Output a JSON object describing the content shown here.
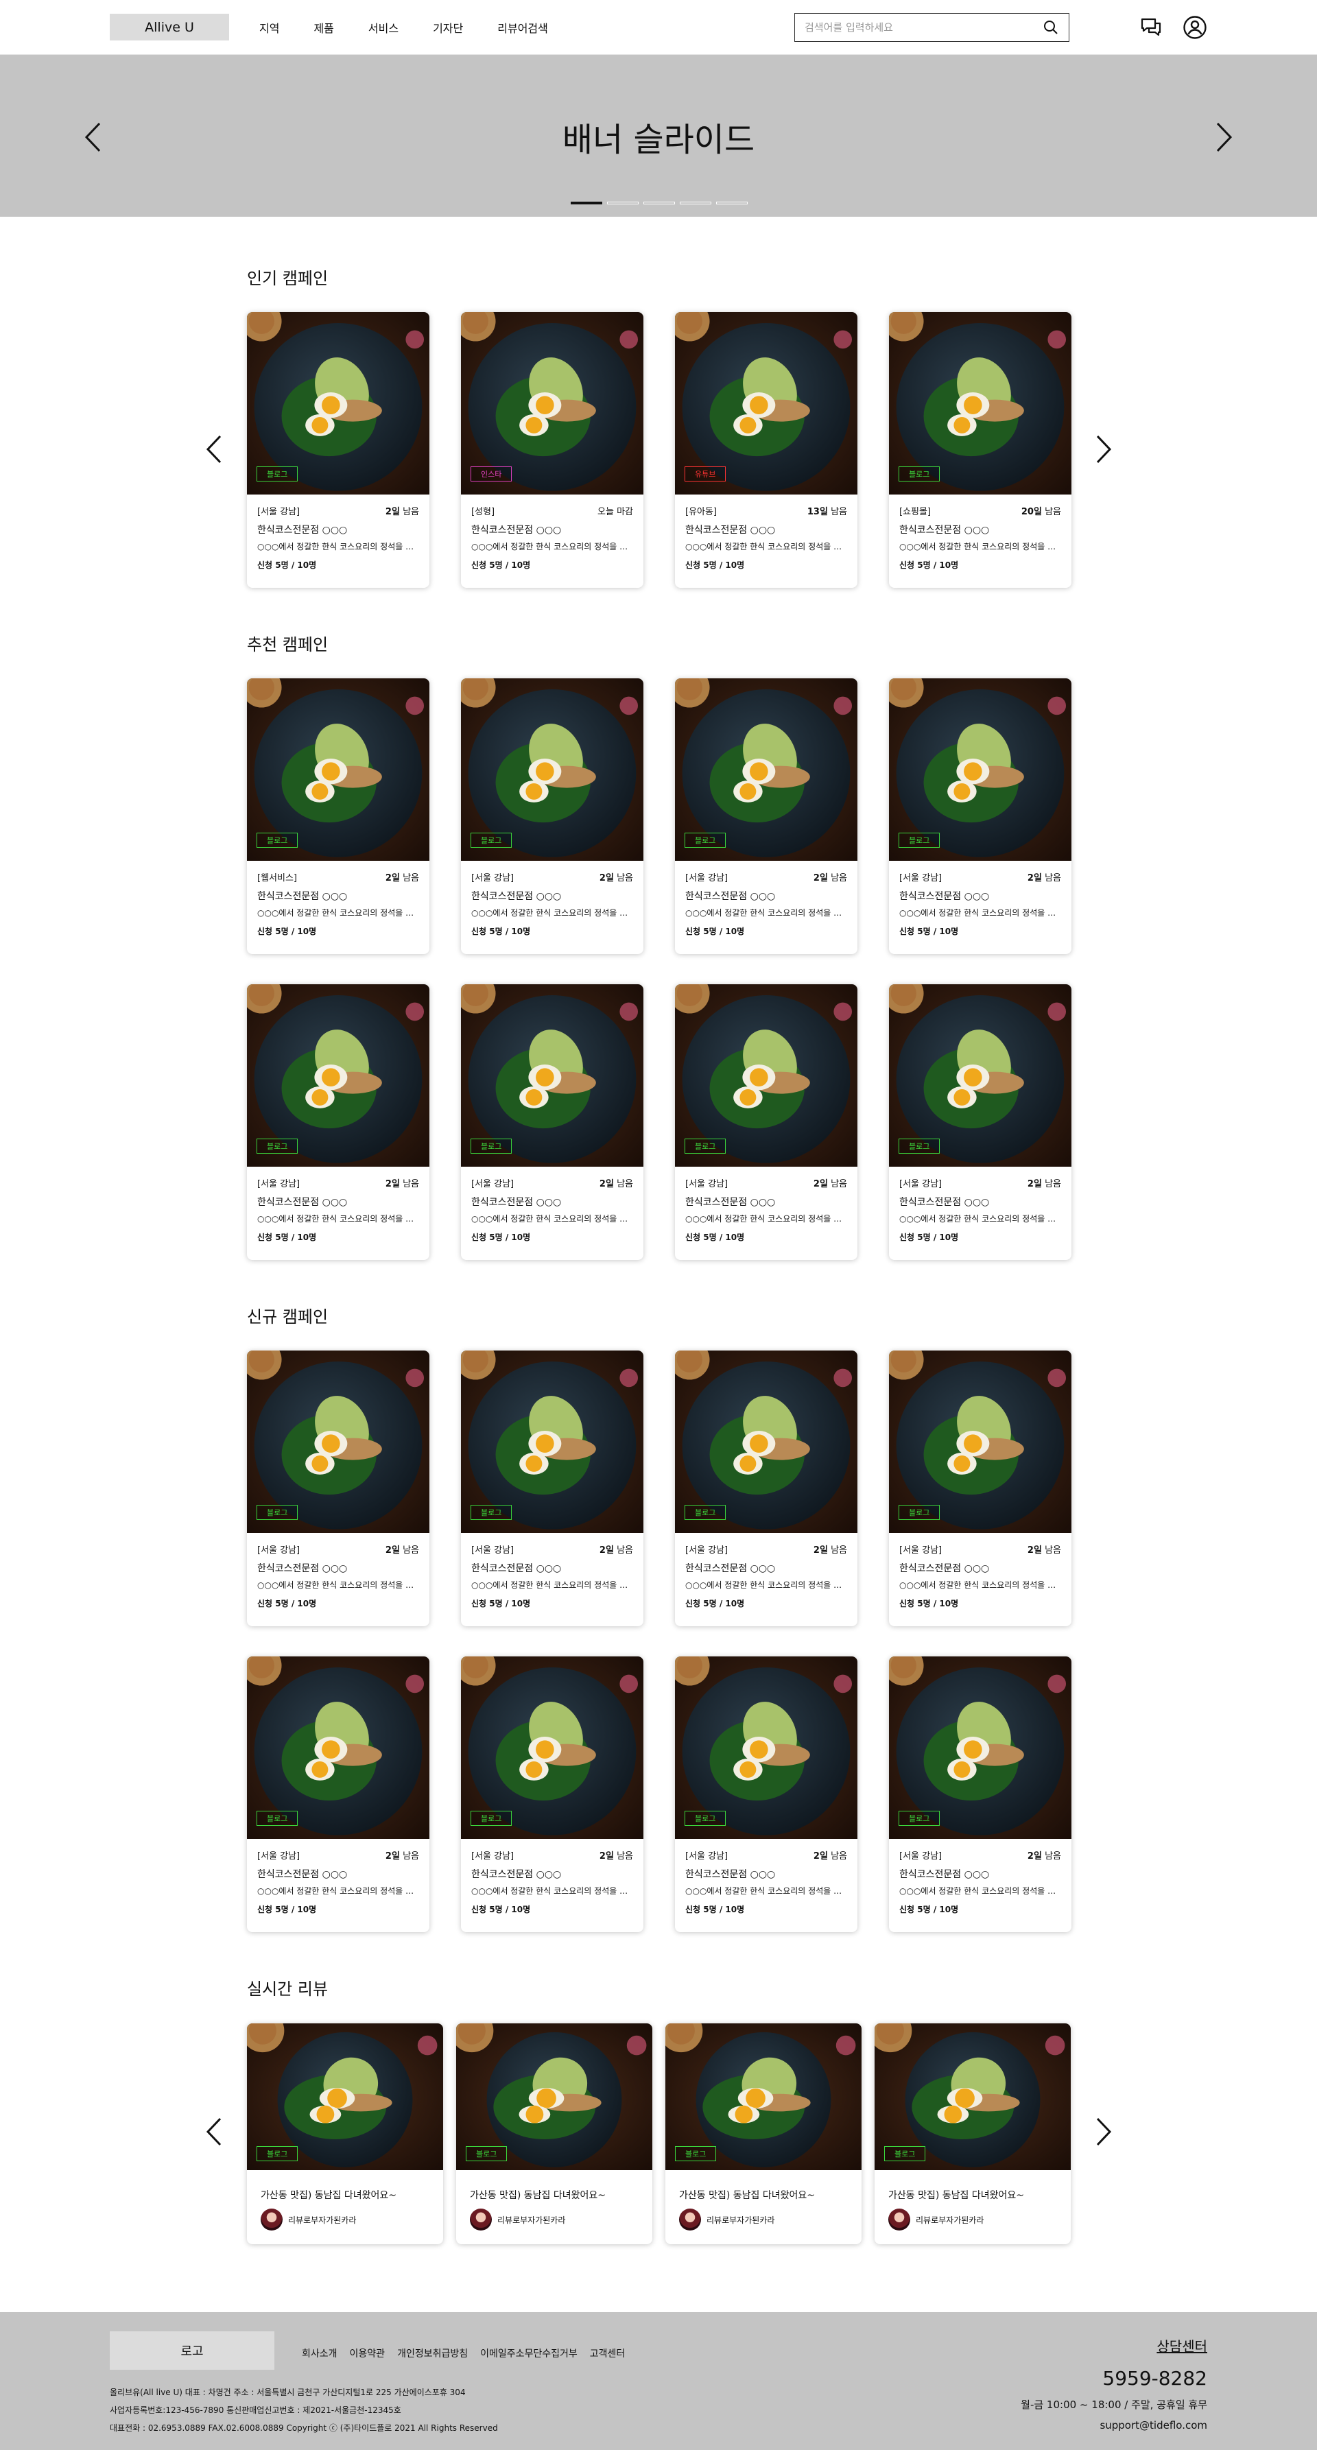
{
  "header": {
    "logo": "Allive U",
    "nav": [
      "지역",
      "제품",
      "서비스",
      "기자단",
      "리뷰어검색"
    ],
    "search_placeholder": "검색어를 입력하세요"
  },
  "banner": {
    "title": "배너 슬라이드",
    "slide_count": 5,
    "active_slide": 0
  },
  "sections": {
    "popular": {
      "title": "인기 캠페인",
      "cards": [
        {
          "tag": "블로그",
          "tag_color": "#3bd63b",
          "region": "[서울 강남]",
          "dday_num": "2일",
          "dday_suffix": " 남음",
          "name": "한식코스전문점 ○○○",
          "desc": "○○○에서 정갈한 한식 코스요리의 정석을 맛보세요",
          "apply": "신청 5명 / 10명"
        },
        {
          "tag": "인스타",
          "tag_color": "#e040c0",
          "region": "[성형]",
          "dday_num": "",
          "dday_suffix": "오늘 마감",
          "name": "한식코스전문점 ○○○",
          "desc": "○○○에서 정갈한 한식 코스요리의 정석을 맛보세요",
          "apply": "신청 5명 / 10명"
        },
        {
          "tag": "유튜브",
          "tag_color": "#ff3333",
          "region": "[유아동]",
          "dday_num": "13일",
          "dday_suffix": " 남음",
          "name": "한식코스전문점 ○○○",
          "desc": "○○○에서 정갈한 한식 코스요리의 정석을 맛보세요",
          "apply": "신청 5명 / 10명"
        },
        {
          "tag": "블로그",
          "tag_color": "#3bd63b",
          "region": "[쇼핑몰]",
          "dday_num": "20일",
          "dday_suffix": " 남음",
          "name": "한식코스전문점 ○○○",
          "desc": "○○○에서 정갈한 한식 코스요리의 정석을 맛보세요",
          "apply": "신청 5명 / 10명"
        }
      ]
    },
    "recommended": {
      "title": "추천 캠페인",
      "cards": [
        {
          "tag": "블로그",
          "tag_color": "#3bd63b",
          "region": "[웹서비스]",
          "dday_num": "2일",
          "dday_suffix": " 남음",
          "name": "한식코스전문점 ○○○",
          "desc": "○○○에서 정갈한 한식 코스요리의 정석을 맛보세요",
          "apply": "신청 5명 / 10명"
        },
        {
          "tag": "블로그",
          "tag_color": "#3bd63b",
          "region": "[서울 강남]",
          "dday_num": "2일",
          "dday_suffix": " 남음",
          "name": "한식코스전문점 ○○○",
          "desc": "○○○에서 정갈한 한식 코스요리의 정석을 맛보세요",
          "apply": "신청 5명 / 10명"
        },
        {
          "tag": "블로그",
          "tag_color": "#3bd63b",
          "region": "[서울 강남]",
          "dday_num": "2일",
          "dday_suffix": " 남음",
          "name": "한식코스전문점 ○○○",
          "desc": "○○○에서 정갈한 한식 코스요리의 정석을 맛보세요",
          "apply": "신청 5명 / 10명"
        },
        {
          "tag": "블로그",
          "tag_color": "#3bd63b",
          "region": "[서울 강남]",
          "dday_num": "2일",
          "dday_suffix": " 남음",
          "name": "한식코스전문점 ○○○",
          "desc": "○○○에서 정갈한 한식 코스요리의 정석을 맛보세요",
          "apply": "신청 5명 / 10명"
        },
        {
          "tag": "블로그",
          "tag_color": "#3bd63b",
          "region": "[서울 강남]",
          "dday_num": "2일",
          "dday_suffix": " 남음",
          "name": "한식코스전문점 ○○○",
          "desc": "○○○에서 정갈한 한식 코스요리의 정석을 맛보세요",
          "apply": "신청 5명 / 10명"
        },
        {
          "tag": "블로그",
          "tag_color": "#3bd63b",
          "region": "[서울 강남]",
          "dday_num": "2일",
          "dday_suffix": " 남음",
          "name": "한식코스전문점 ○○○",
          "desc": "○○○에서 정갈한 한식 코스요리의 정석을 맛보세요",
          "apply": "신청 5명 / 10명"
        },
        {
          "tag": "블로그",
          "tag_color": "#3bd63b",
          "region": "[서울 강남]",
          "dday_num": "2일",
          "dday_suffix": " 남음",
          "name": "한식코스전문점 ○○○",
          "desc": "○○○에서 정갈한 한식 코스요리의 정석을 맛보세요",
          "apply": "신청 5명 / 10명"
        },
        {
          "tag": "블로그",
          "tag_color": "#3bd63b",
          "region": "[서울 강남]",
          "dday_num": "2일",
          "dday_suffix": " 남음",
          "name": "한식코스전문점 ○○○",
          "desc": "○○○에서 정갈한 한식 코스요리의 정석을 맛보세요",
          "apply": "신청 5명 / 10명"
        }
      ]
    },
    "new": {
      "title": "신규 캠페인",
      "cards": [
        {
          "tag": "블로그",
          "tag_color": "#3bd63b",
          "region": "[서울 강남]",
          "dday_num": "2일",
          "dday_suffix": " 남음",
          "name": "한식코스전문점 ○○○",
          "desc": "○○○에서 정갈한 한식 코스요리의 정석을 맛보세요",
          "apply": "신청 5명 / 10명"
        },
        {
          "tag": "블로그",
          "tag_color": "#3bd63b",
          "region": "[서울 강남]",
          "dday_num": "2일",
          "dday_suffix": " 남음",
          "name": "한식코스전문점 ○○○",
          "desc": "○○○에서 정갈한 한식 코스요리의 정석을 맛보세요",
          "apply": "신청 5명 / 10명"
        },
        {
          "tag": "블로그",
          "tag_color": "#3bd63b",
          "region": "[서울 강남]",
          "dday_num": "2일",
          "dday_suffix": " 남음",
          "name": "한식코스전문점 ○○○",
          "desc": "○○○에서 정갈한 한식 코스요리의 정석을 맛보세요",
          "apply": "신청 5명 / 10명"
        },
        {
          "tag": "블로그",
          "tag_color": "#3bd63b",
          "region": "[서울 강남]",
          "dday_num": "2일",
          "dday_suffix": " 남음",
          "name": "한식코스전문점 ○○○",
          "desc": "○○○에서 정갈한 한식 코스요리의 정석을 맛보세요",
          "apply": "신청 5명 / 10명"
        },
        {
          "tag": "블로그",
          "tag_color": "#3bd63b",
          "region": "[서울 강남]",
          "dday_num": "2일",
          "dday_suffix": " 남음",
          "name": "한식코스전문점 ○○○",
          "desc": "○○○에서 정갈한 한식 코스요리의 정석을 맛보세요",
          "apply": "신청 5명 / 10명"
        },
        {
          "tag": "블로그",
          "tag_color": "#3bd63b",
          "region": "[서울 강남]",
          "dday_num": "2일",
          "dday_suffix": " 남음",
          "name": "한식코스전문점 ○○○",
          "desc": "○○○에서 정갈한 한식 코스요리의 정석을 맛보세요",
          "apply": "신청 5명 / 10명"
        },
        {
          "tag": "블로그",
          "tag_color": "#3bd63b",
          "region": "[서울 강남]",
          "dday_num": "2일",
          "dday_suffix": " 남음",
          "name": "한식코스전문점 ○○○",
          "desc": "○○○에서 정갈한 한식 코스요리의 정석을 맛보세요",
          "apply": "신청 5명 / 10명"
        },
        {
          "tag": "블로그",
          "tag_color": "#3bd63b",
          "region": "[서울 강남]",
          "dday_num": "2일",
          "dday_suffix": " 남음",
          "name": "한식코스전문점 ○○○",
          "desc": "○○○에서 정갈한 한식 코스요리의 정석을 맛보세요",
          "apply": "신청 5명 / 10명"
        }
      ]
    },
    "reviews": {
      "title": "실시간 리뷰",
      "cards": [
        {
          "tag": "블로그",
          "title": "가산동 맛집) 동남집 다녀왔어요~",
          "reviewer": "리뷰로부자가된카라"
        },
        {
          "tag": "블로그",
          "title": "가산동 맛집) 동남집 다녀왔어요~",
          "reviewer": "리뷰로부자가된카라"
        },
        {
          "tag": "블로그",
          "title": "가산동 맛집) 동남집 다녀왔어요~",
          "reviewer": "리뷰로부자가된카라"
        },
        {
          "tag": "블로그",
          "title": "가산동 맛집) 동남집 다녀왔어요~",
          "reviewer": "리뷰로부자가된카라"
        }
      ]
    }
  },
  "footer": {
    "logo": "로고",
    "links": [
      "회사소개",
      "이용약관",
      "개인정보취급방침",
      "이메일주소무단수집거부",
      "고객센터"
    ],
    "info": [
      "올리브유(All live U)   대표 : 차명건   주소 : 서울특별시 금천구 가산디지털1로 225 가산에이스포휴 304",
      "사업자등록번호:123-456-7890   통신판매업신고번호 : 제2021-서울금천-12345호",
      "대표전화 : 02.6953.0889   FAX.02.6008.0889   Copyright ⓒ (주)타이드플로 2021 All Rights Reserved"
    ],
    "cs_label": "상담센터",
    "phone": "5959-8282",
    "hours": "월-금 10:00 ~ 18:00 / 주말, 공휴일 휴무",
    "email": "support@tideflo.com"
  }
}
